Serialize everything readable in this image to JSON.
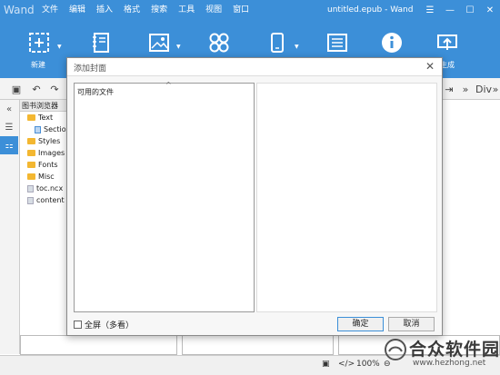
{
  "app": {
    "logo": "Wand",
    "doc_title": "untitled.epub - Wand"
  },
  "menu": [
    "文件",
    "编辑",
    "插入",
    "格式",
    "搜索",
    "工具",
    "视图",
    "窗口"
  ],
  "ribbon": {
    "new_label": "新建",
    "generate_label": "生成"
  },
  "browser": {
    "title": "图书浏览器",
    "items": [
      {
        "label": "Text",
        "type": "folder"
      },
      {
        "label": "Section",
        "type": "file-blue"
      },
      {
        "label": "Styles",
        "type": "folder"
      },
      {
        "label": "Images",
        "type": "folder"
      },
      {
        "label": "Fonts",
        "type": "folder"
      },
      {
        "label": "Misc",
        "type": "folder"
      },
      {
        "label": "toc.ncx",
        "type": "file"
      },
      {
        "label": "content",
        "type": "file"
      }
    ]
  },
  "toolbar": {
    "div_label": "Div"
  },
  "dialog": {
    "title": "添加封面",
    "files_label": "可用的文件",
    "fullscreen_label": "全屏（多看）",
    "ok_label": "确定",
    "cancel_label": "取消"
  },
  "status": {
    "zoom": "100%"
  },
  "watermark": {
    "text": "合众软件园",
    "url": "www.hezhong.net"
  },
  "colors": {
    "accent": "#3c8fd8"
  }
}
